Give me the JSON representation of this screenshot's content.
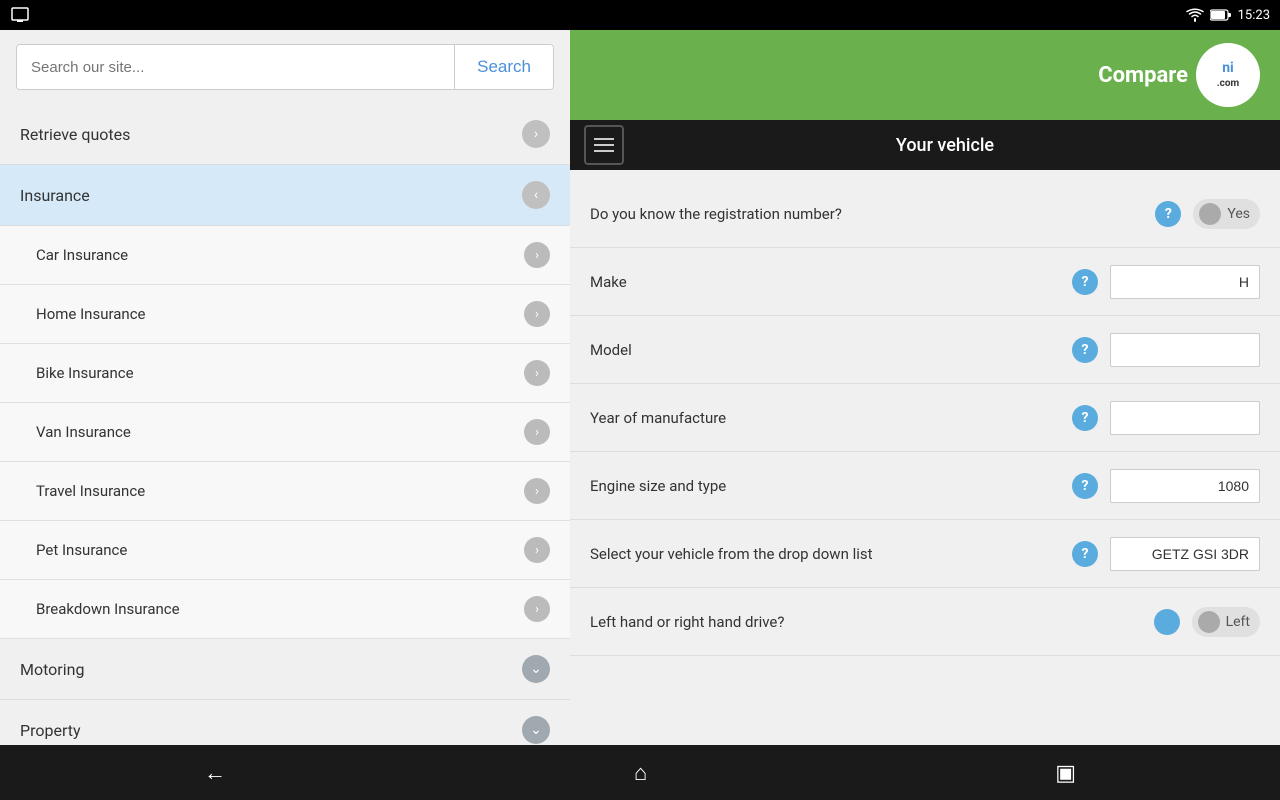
{
  "statusBar": {
    "time": "15:23",
    "wifiIcon": "wifi-icon",
    "batteryIcon": "battery-icon",
    "screenIcon": "screen-icon"
  },
  "leftPanel": {
    "searchInput": {
      "placeholder": "Search our site...",
      "value": ""
    },
    "searchButton": "Search",
    "navItems": [
      {
        "id": "retrieve-quotes",
        "label": "Retrieve quotes",
        "type": "arrow",
        "active": false
      },
      {
        "id": "insurance",
        "label": "Insurance",
        "type": "up",
        "active": true
      },
      {
        "id": "car-insurance",
        "label": "Car Insurance",
        "type": "sub-arrow"
      },
      {
        "id": "home-insurance",
        "label": "Home Insurance",
        "type": "sub-arrow"
      },
      {
        "id": "bike-insurance",
        "label": "Bike Insurance",
        "type": "sub-arrow"
      },
      {
        "id": "van-insurance",
        "label": "Van Insurance",
        "type": "sub-arrow"
      },
      {
        "id": "travel-insurance",
        "label": "Travel Insurance",
        "type": "sub-arrow"
      },
      {
        "id": "pet-insurance",
        "label": "Pet Insurance",
        "type": "sub-arrow"
      },
      {
        "id": "breakdown-insurance",
        "label": "Breakdown Insurance",
        "type": "sub-arrow"
      },
      {
        "id": "motoring",
        "label": "Motoring",
        "type": "down",
        "active": false
      },
      {
        "id": "property",
        "label": "Property",
        "type": "down",
        "active": false
      }
    ]
  },
  "rightPanel": {
    "logo": {
      "text": "Compare",
      "suffix": "ni",
      "domain": ".com"
    },
    "pageTitle": "Your vehicle",
    "formFields": [
      {
        "id": "reg-number",
        "label": "Do you know the registration number?",
        "type": "toggle",
        "value": "Yes"
      },
      {
        "id": "make",
        "label": "Make",
        "type": "text",
        "value": "H"
      },
      {
        "id": "model",
        "label": "Model",
        "type": "text",
        "value": ""
      },
      {
        "id": "year",
        "label": "Year of manufacture",
        "type": "text",
        "value": ""
      },
      {
        "id": "engine",
        "label": "Engine size and type",
        "type": "text",
        "value": "1080"
      },
      {
        "id": "vehicle-select",
        "label": "Select your vehicle from the drop down list",
        "type": "text",
        "value": "GETZ GSI 3DR"
      },
      {
        "id": "drive",
        "label": "Left hand or right hand drive?",
        "type": "toggle",
        "value": "Left"
      }
    ]
  },
  "bottomNav": {
    "backLabel": "←",
    "homeLabel": "⌂",
    "recentLabel": "▣"
  }
}
